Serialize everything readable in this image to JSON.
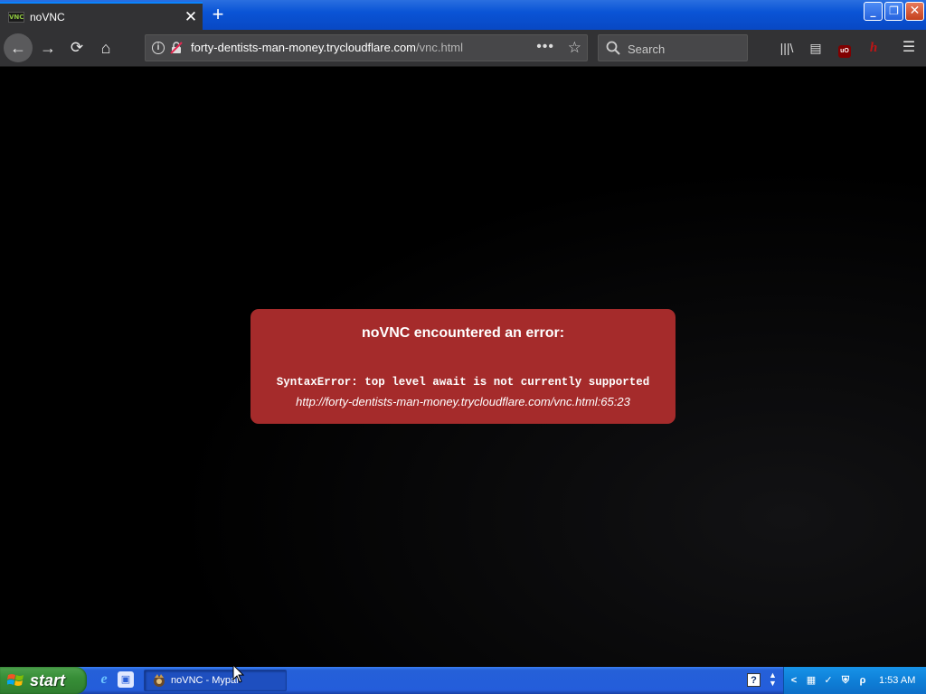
{
  "browser": {
    "tab": {
      "favicon_text": "VNC",
      "title": "noVNC",
      "close_glyph": "✕"
    },
    "newtab_glyph": "+",
    "window_buttons": {
      "minimize": "_",
      "restore": "❐",
      "close": "✕"
    },
    "nav": {
      "back_glyph": "←",
      "forward_glyph": "→",
      "reload_glyph": "⟳",
      "home_glyph": "⌂"
    },
    "url": {
      "host": "forty-dentists-man-money.trycloudflare.com",
      "path": "/vnc.html",
      "info_glyph": "i",
      "more_glyph": "•••",
      "star_glyph": "☆"
    },
    "search": {
      "placeholder": "Search"
    },
    "toolbar": {
      "library_glyph": "|||\\",
      "sidebar_glyph": "▤",
      "ublock_text": "uO",
      "ext_h_text": "h",
      "menu_glyph": "☰"
    },
    "accent_color": "#0a84ff"
  },
  "error": {
    "title": "noVNC encountered an error:",
    "message": "SyntaxError: top level await is not currently supported",
    "location": "http://forty-dentists-man-money.trycloudflare.com/vnc.html:65:23",
    "background_color": "#a52b2b"
  },
  "taskbar": {
    "start_label": "start",
    "quick_launch": [
      {
        "name": "internet-explorer",
        "glyph": "e"
      },
      {
        "name": "show-desktop",
        "glyph": "▣"
      }
    ],
    "task_item_label": "noVNC - Mypal",
    "help_glyph": "?",
    "tray_icons": [
      "<",
      "▦",
      "✓",
      "⛨",
      "ρ"
    ],
    "clock": "1:53 AM"
  }
}
